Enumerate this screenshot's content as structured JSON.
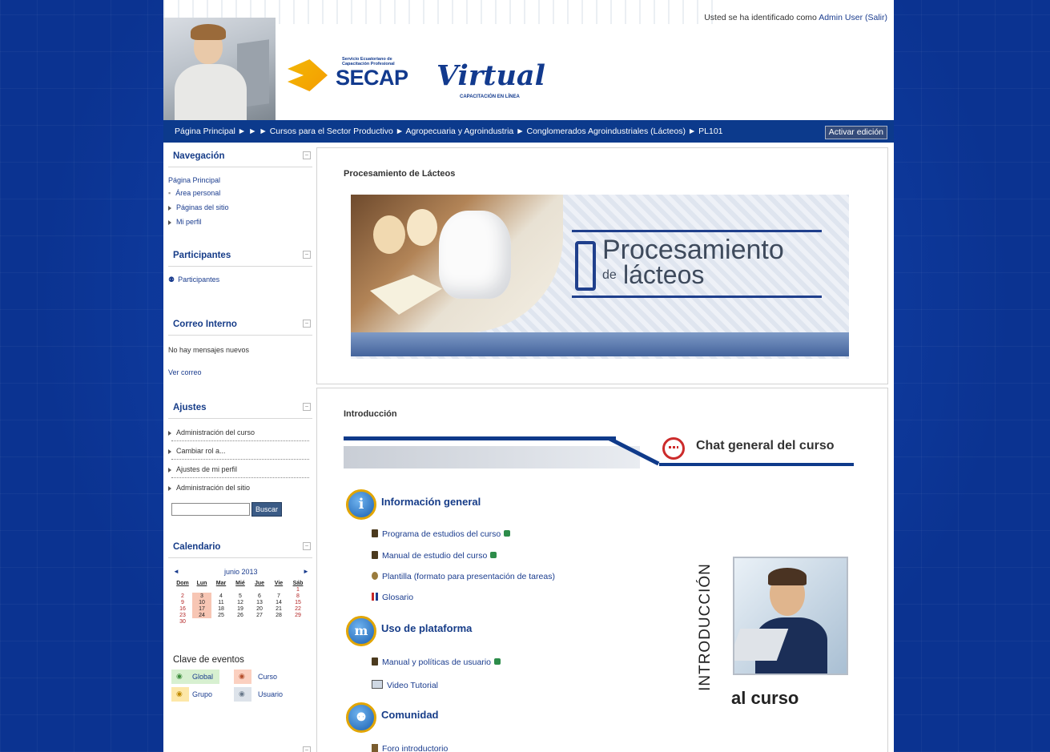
{
  "header": {
    "login_prefix": "Usted se ha identificado como ",
    "login_user": "Admin User",
    "logout": "(Salir)",
    "logo_small": "Servicio Ecuatoriano de Capacitación Profesional",
    "logo_main": "SECAP",
    "logo_virtual": "Virtual",
    "logo_tagline": "CAPACITACIÓN EN LÍNEA"
  },
  "breadcrumb": {
    "text": "Página Principal ► ► ► Cursos para el Sector Productivo ► Agropecuaria y Agroindustria ► Conglomerados Agroindustriales (Lácteos) ► PL101",
    "edit_button": "Activar edición"
  },
  "nav": {
    "title": "Navegación",
    "home": "Página Principal",
    "items": [
      "Área personal",
      "Páginas del sitio",
      "Mi perfil"
    ]
  },
  "participants": {
    "title": "Participantes",
    "link": "Participantes"
  },
  "mail": {
    "title": "Correo Interno",
    "status": "No hay mensajes nuevos",
    "link": "Ver correo"
  },
  "settings": {
    "title": "Ajustes",
    "items": [
      "Administración del curso",
      "Cambiar rol a...",
      "Ajustes de mi perfil",
      "Administración del sitio"
    ],
    "search_button": "Buscar",
    "search_value": ""
  },
  "calendar": {
    "title": "Calendario",
    "month": "junio 2013",
    "days": [
      "Dom",
      "Lun",
      "Mar",
      "Mié",
      "Jue",
      "Vie",
      "Sáb"
    ],
    "weeks": [
      [
        "",
        "",
        "",
        "",
        "",
        "",
        "1"
      ],
      [
        "2",
        "3",
        "4",
        "5",
        "6",
        "7",
        "8"
      ],
      [
        "9",
        "10",
        "11",
        "12",
        "13",
        "14",
        "15"
      ],
      [
        "16",
        "17",
        "18",
        "19",
        "20",
        "21",
        "22"
      ],
      [
        "23",
        "24",
        "25",
        "26",
        "27",
        "28",
        "29"
      ],
      [
        "30",
        "",
        "",
        "",
        "",
        "",
        ""
      ]
    ],
    "events_title": "Clave de eventos",
    "events": [
      "Global",
      "Curso",
      "Grupo",
      "Usuario"
    ]
  },
  "main": {
    "section1_title": "Procesamiento de Lácteos",
    "banner_line1": "Procesamiento",
    "banner_line2a": "de",
    "banner_line2b": "lácteos",
    "section2_title": "Introducción",
    "chat_label": "Chat general del curso",
    "cat1": {
      "title": "Información general",
      "icon": "i"
    },
    "cat1_items": [
      "Programa de estudios del curso",
      "Manual de estudio del curso",
      "Plantilla (formato para presentación de tareas)",
      "Glosario"
    ],
    "cat2": {
      "title": "Uso de plataforma",
      "icon": "m"
    },
    "cat2_items": [
      "Manual y políticas de usuario",
      "Video Tutorial"
    ],
    "cat3": {
      "title": "Comunidad"
    },
    "cat3_items": [
      "Foro introductorio"
    ],
    "intro_vertical": "INTRODUCCIÓN",
    "intro_bottom": "al curso"
  }
}
